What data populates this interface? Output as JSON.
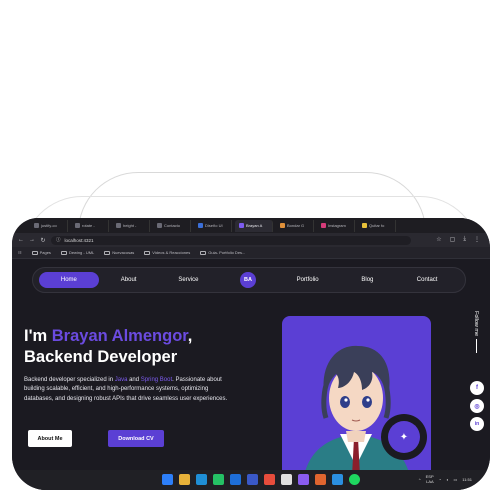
{
  "browser": {
    "tabs": [
      {
        "label": "justify-co"
      },
      {
        "label": "rotate - "
      },
      {
        "label": "height - "
      },
      {
        "label": "Contacto"
      },
      {
        "label": "Diseño UI"
      },
      {
        "label": "Brayan A",
        "active": true
      },
      {
        "label": "Bondar G"
      },
      {
        "label": "Instagram"
      },
      {
        "label": "Quitar fo"
      }
    ],
    "url": "localhost:4321",
    "bookmarks": [
      {
        "label": "Pages"
      },
      {
        "label": "Dewing - UML"
      },
      {
        "label": "Nuevacosas"
      },
      {
        "label": "Videos & Reacciones"
      },
      {
        "label": "Guia- Portfolio Des..."
      }
    ]
  },
  "navbar": {
    "items": [
      "Home",
      "About",
      "Service",
      "Portfolio",
      "Blog",
      "Contact"
    ],
    "active": "Home",
    "logo": "BA"
  },
  "hero": {
    "greeting": "I'm ",
    "name": "Brayan Almengor",
    "comma": ",",
    "role": "Backend Developer",
    "desc_1": "Backend developer specialized in ",
    "java": "Java",
    "and": " and ",
    "spring": "Spring Boot",
    "desc_2": ". Passionate about building scalable, efficient, and high-performance systems, optimizing databases, and designing robust APIs that drive seamless user experiences.",
    "btn_about": "About Me",
    "btn_cv": "Download CV"
  },
  "follow": {
    "label": "Follow me"
  },
  "social": [
    {
      "icon": "facebook-icon",
      "glyph": "f"
    },
    {
      "icon": "instagram-icon",
      "glyph": "◎"
    },
    {
      "icon": "linkedin-icon",
      "glyph": "in"
    }
  ],
  "taskbar": {
    "lang": "ESP",
    "region": "LAA",
    "time": "11:51"
  },
  "colors": {
    "accent": "#5b3fd4",
    "background": "#1b1a21"
  }
}
